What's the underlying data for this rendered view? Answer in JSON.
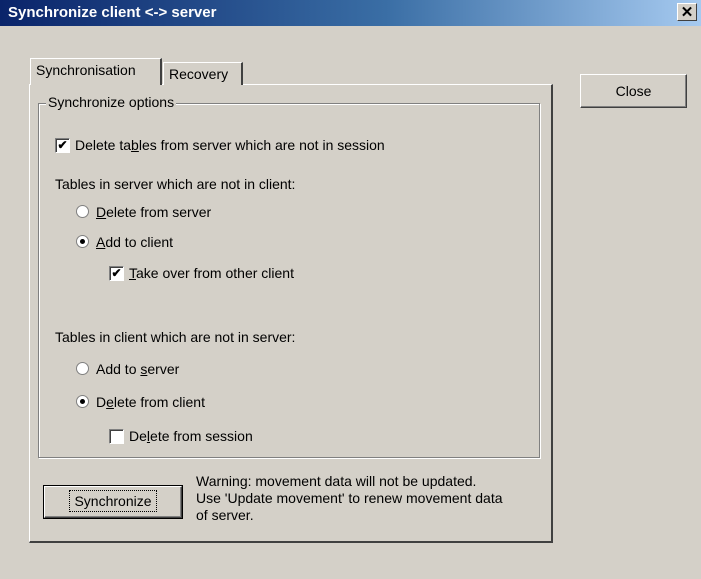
{
  "window": {
    "title": "Synchronize client <-> server",
    "close_glyph": "✕"
  },
  "buttons": {
    "close": "Close",
    "synchronize": "Synchronize"
  },
  "tabs": [
    {
      "label": "Synchronisation",
      "active": true
    },
    {
      "label": "Recovery",
      "active": false
    }
  ],
  "group": {
    "title": "Synchronize options",
    "delete_tables": {
      "pre": "Delete ta",
      "accel": "b",
      "post": "les from server which are not in session",
      "checked": true
    },
    "server_not_client_label": "Tables in server which are not in client:",
    "delete_from_server": {
      "pre": "",
      "accel": "D",
      "post": "elete from server",
      "selected": false
    },
    "add_to_client": {
      "pre": "",
      "accel": "A",
      "post": "dd to client",
      "selected": true
    },
    "take_over": {
      "pre": "",
      "accel": "T",
      "post": "ake over from other client",
      "checked": true
    },
    "client_not_server_label": "Tables in client which are not in server:",
    "add_to_server": {
      "pre": "Add to ",
      "accel": "s",
      "post": "erver",
      "selected": false
    },
    "delete_from_client": {
      "pre": "D",
      "accel": "e",
      "post": "lete from client",
      "selected": true
    },
    "delete_from_session": {
      "pre": "De",
      "accel": "l",
      "post": "ete from session",
      "checked": false
    }
  },
  "warning": {
    "line1": "Warning: movement data will not be updated.",
    "line2": "Use 'Update movement' to renew movement data",
    "line3": "of server."
  },
  "check_glyph": "✔"
}
